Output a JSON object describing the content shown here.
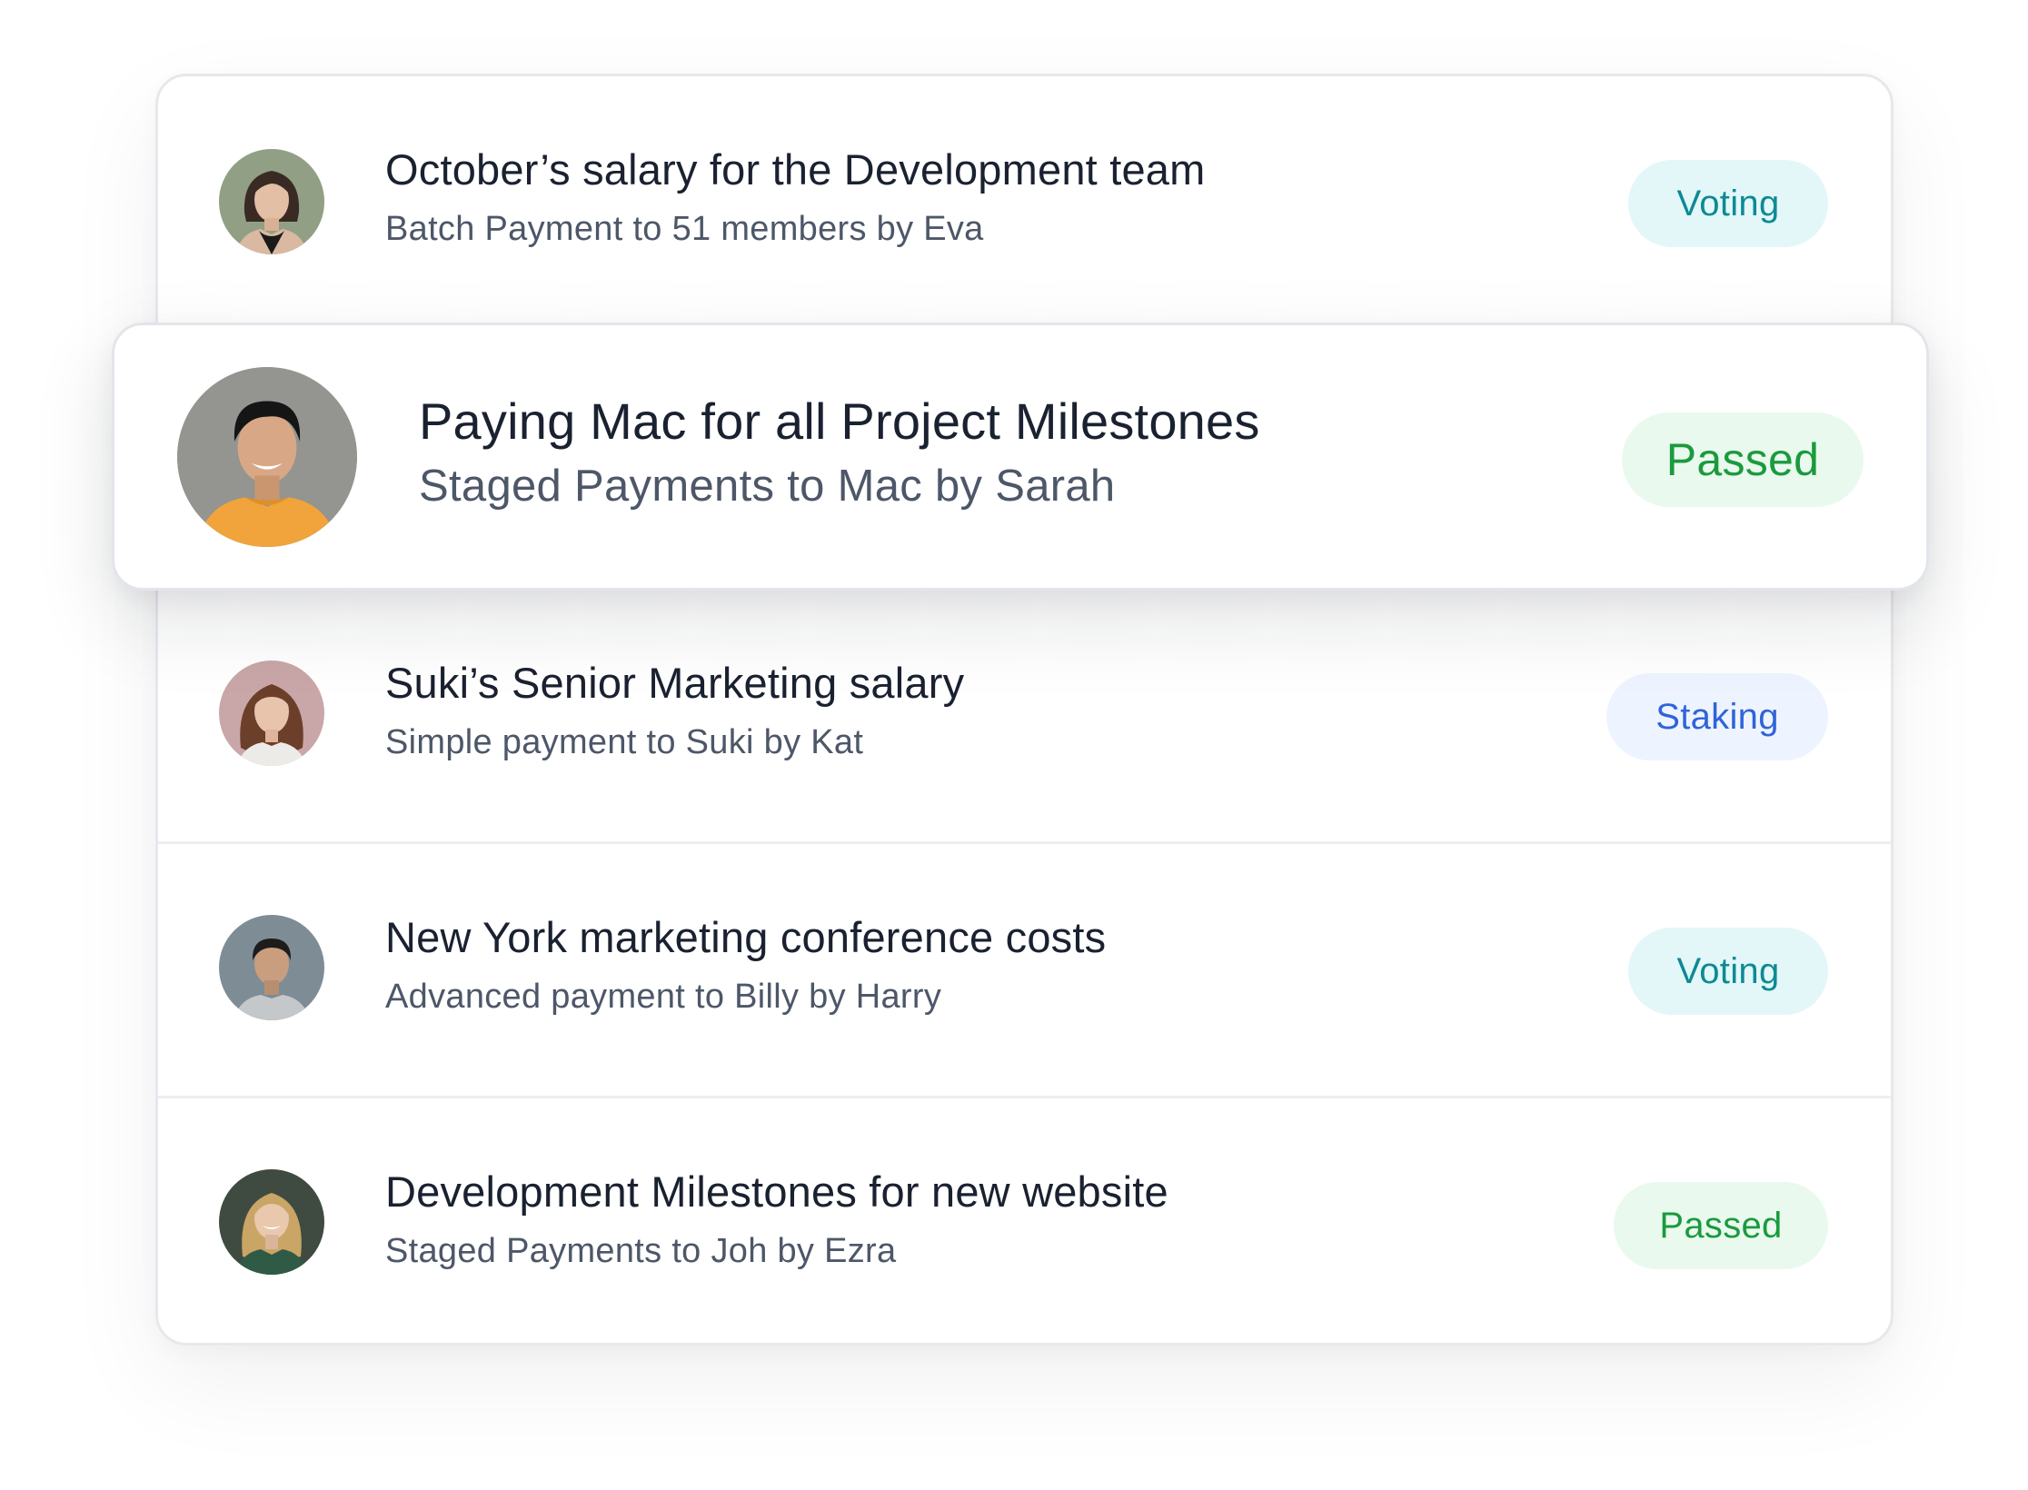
{
  "colors": {
    "voting_bg": "#e3f7f8",
    "voting_text": "#0d8a94",
    "staking_bg": "#eef4ff",
    "staking_text": "#2f64d8",
    "passed_bg": "#e9f9ee",
    "passed_text": "#1b9a3e",
    "title_text": "#1a2130",
    "subtitle_text": "#4d5768"
  },
  "items": [
    {
      "title": "October’s salary for the Development team",
      "subtitle": "Batch Payment to 51 members by Eva",
      "status": "Voting",
      "avatar_icon": "avatar-woman-dark-hair"
    },
    {
      "title": "Paying Mac for all Project Milestones",
      "subtitle": "Staged Payments to Mac by Sarah",
      "status": "Passed",
      "avatar_icon": "avatar-man-orange-sweater"
    },
    {
      "title": "Suki’s Senior Marketing salary",
      "subtitle": "Simple payment to Suki by Kat",
      "status": "Staking",
      "avatar_icon": "avatar-woman-wavy-hair"
    },
    {
      "title": "New York marketing conference costs",
      "subtitle": "Advanced payment to Billy by Harry",
      "status": "Voting",
      "avatar_icon": "avatar-man-grey-shirt"
    },
    {
      "title": "Development Milestones for new website",
      "subtitle": "Staged Payments to Joh by Ezra",
      "status": "Passed",
      "avatar_icon": "avatar-woman-blonde"
    }
  ]
}
